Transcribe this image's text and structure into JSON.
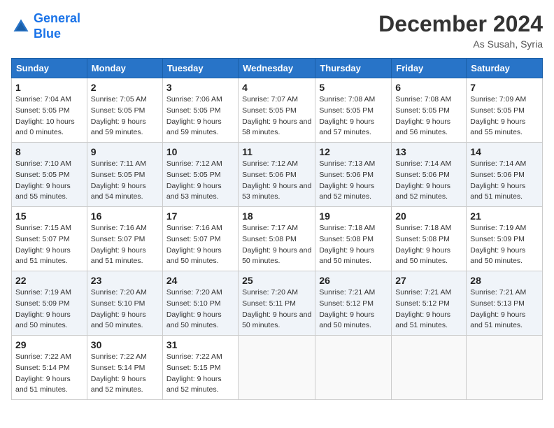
{
  "logo": {
    "line1": "General",
    "line2": "Blue"
  },
  "title": "December 2024",
  "location": "As Susah, Syria",
  "weekdays": [
    "Sunday",
    "Monday",
    "Tuesday",
    "Wednesday",
    "Thursday",
    "Friday",
    "Saturday"
  ],
  "weeks": [
    [
      {
        "day": "1",
        "sunrise": "7:04 AM",
        "sunset": "5:05 PM",
        "daylight": "10 hours and 0 minutes."
      },
      {
        "day": "2",
        "sunrise": "7:05 AM",
        "sunset": "5:05 PM",
        "daylight": "9 hours and 59 minutes."
      },
      {
        "day": "3",
        "sunrise": "7:06 AM",
        "sunset": "5:05 PM",
        "daylight": "9 hours and 59 minutes."
      },
      {
        "day": "4",
        "sunrise": "7:07 AM",
        "sunset": "5:05 PM",
        "daylight": "9 hours and 58 minutes."
      },
      {
        "day": "5",
        "sunrise": "7:08 AM",
        "sunset": "5:05 PM",
        "daylight": "9 hours and 57 minutes."
      },
      {
        "day": "6",
        "sunrise": "7:08 AM",
        "sunset": "5:05 PM",
        "daylight": "9 hours and 56 minutes."
      },
      {
        "day": "7",
        "sunrise": "7:09 AM",
        "sunset": "5:05 PM",
        "daylight": "9 hours and 55 minutes."
      }
    ],
    [
      {
        "day": "8",
        "sunrise": "7:10 AM",
        "sunset": "5:05 PM",
        "daylight": "9 hours and 55 minutes."
      },
      {
        "day": "9",
        "sunrise": "7:11 AM",
        "sunset": "5:05 PM",
        "daylight": "9 hours and 54 minutes."
      },
      {
        "day": "10",
        "sunrise": "7:12 AM",
        "sunset": "5:05 PM",
        "daylight": "9 hours and 53 minutes."
      },
      {
        "day": "11",
        "sunrise": "7:12 AM",
        "sunset": "5:06 PM",
        "daylight": "9 hours and 53 minutes."
      },
      {
        "day": "12",
        "sunrise": "7:13 AM",
        "sunset": "5:06 PM",
        "daylight": "9 hours and 52 minutes."
      },
      {
        "day": "13",
        "sunrise": "7:14 AM",
        "sunset": "5:06 PM",
        "daylight": "9 hours and 52 minutes."
      },
      {
        "day": "14",
        "sunrise": "7:14 AM",
        "sunset": "5:06 PM",
        "daylight": "9 hours and 51 minutes."
      }
    ],
    [
      {
        "day": "15",
        "sunrise": "7:15 AM",
        "sunset": "5:07 PM",
        "daylight": "9 hours and 51 minutes."
      },
      {
        "day": "16",
        "sunrise": "7:16 AM",
        "sunset": "5:07 PM",
        "daylight": "9 hours and 51 minutes."
      },
      {
        "day": "17",
        "sunrise": "7:16 AM",
        "sunset": "5:07 PM",
        "daylight": "9 hours and 50 minutes."
      },
      {
        "day": "18",
        "sunrise": "7:17 AM",
        "sunset": "5:08 PM",
        "daylight": "9 hours and 50 minutes."
      },
      {
        "day": "19",
        "sunrise": "7:18 AM",
        "sunset": "5:08 PM",
        "daylight": "9 hours and 50 minutes."
      },
      {
        "day": "20",
        "sunrise": "7:18 AM",
        "sunset": "5:08 PM",
        "daylight": "9 hours and 50 minutes."
      },
      {
        "day": "21",
        "sunrise": "7:19 AM",
        "sunset": "5:09 PM",
        "daylight": "9 hours and 50 minutes."
      }
    ],
    [
      {
        "day": "22",
        "sunrise": "7:19 AM",
        "sunset": "5:09 PM",
        "daylight": "9 hours and 50 minutes."
      },
      {
        "day": "23",
        "sunrise": "7:20 AM",
        "sunset": "5:10 PM",
        "daylight": "9 hours and 50 minutes."
      },
      {
        "day": "24",
        "sunrise": "7:20 AM",
        "sunset": "5:10 PM",
        "daylight": "9 hours and 50 minutes."
      },
      {
        "day": "25",
        "sunrise": "7:20 AM",
        "sunset": "5:11 PM",
        "daylight": "9 hours and 50 minutes."
      },
      {
        "day": "26",
        "sunrise": "7:21 AM",
        "sunset": "5:12 PM",
        "daylight": "9 hours and 50 minutes."
      },
      {
        "day": "27",
        "sunrise": "7:21 AM",
        "sunset": "5:12 PM",
        "daylight": "9 hours and 51 minutes."
      },
      {
        "day": "28",
        "sunrise": "7:21 AM",
        "sunset": "5:13 PM",
        "daylight": "9 hours and 51 minutes."
      }
    ],
    [
      {
        "day": "29",
        "sunrise": "7:22 AM",
        "sunset": "5:14 PM",
        "daylight": "9 hours and 51 minutes."
      },
      {
        "day": "30",
        "sunrise": "7:22 AM",
        "sunset": "5:14 PM",
        "daylight": "9 hours and 52 minutes."
      },
      {
        "day": "31",
        "sunrise": "7:22 AM",
        "sunset": "5:15 PM",
        "daylight": "9 hours and 52 minutes."
      },
      null,
      null,
      null,
      null
    ]
  ],
  "labels": {
    "sunrise": "Sunrise:",
    "sunset": "Sunset:",
    "daylight": "Daylight:"
  }
}
